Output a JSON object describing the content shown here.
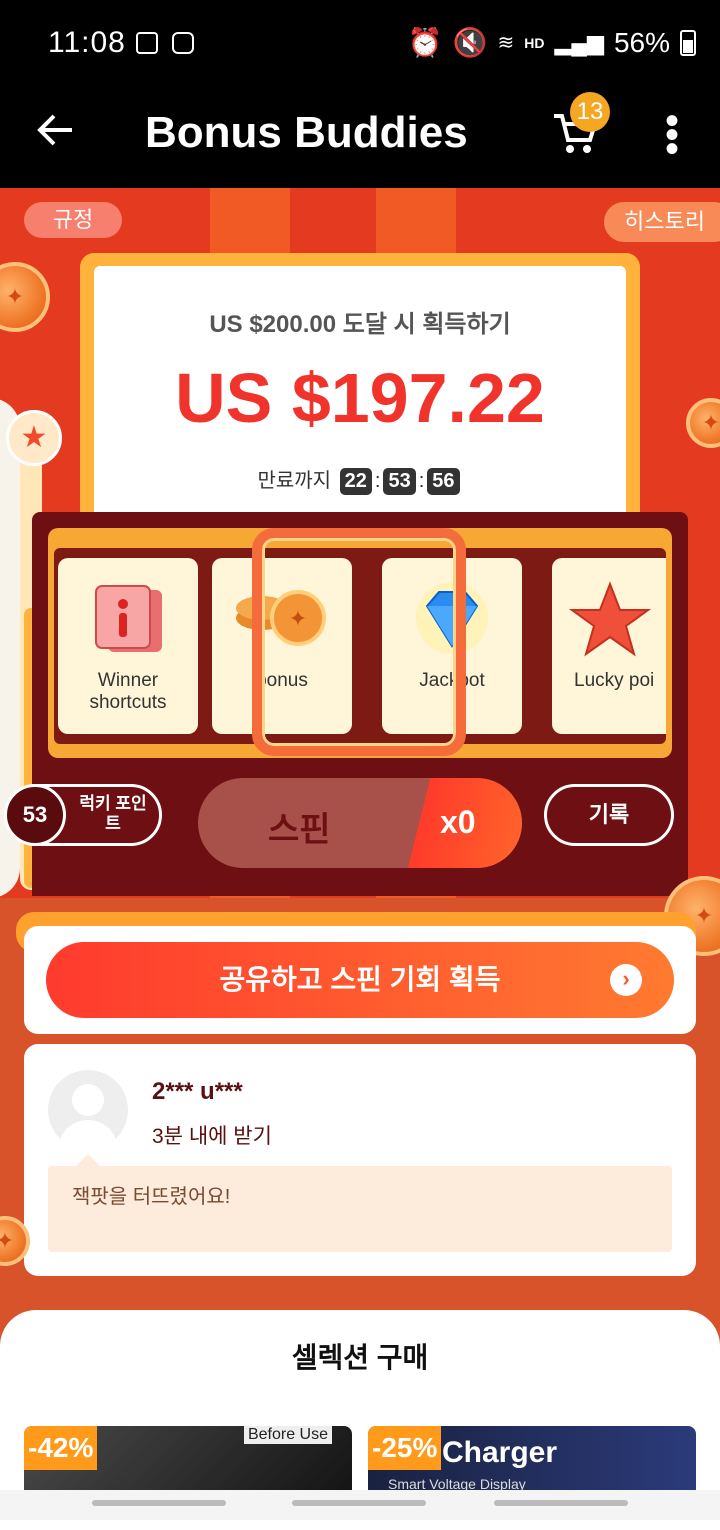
{
  "status": {
    "time": "11:08",
    "battery": "56%",
    "network": "HD"
  },
  "header": {
    "title": "Bonus Buddies",
    "back_icon": "arrow-left-icon",
    "cart_count": "13"
  },
  "hero": {
    "rules_label": "규정",
    "history_label": "히스토리",
    "target_text": "US $200.00 도달 시 획득하기",
    "amount": "US $197.22",
    "expiry_label": "만료까지",
    "timer": {
      "h": "22",
      "m": "53",
      "s": "56"
    }
  },
  "slots": [
    {
      "label": "Winner shortcuts",
      "icon": "info-ticket-icon"
    },
    {
      "label": "bonus",
      "icon": "coins-icon"
    },
    {
      "label": "Jackpot",
      "icon": "diamond-icon"
    },
    {
      "label": "Lucky poi",
      "icon": "star-icon"
    }
  ],
  "controls": {
    "lucky_points": "53",
    "lucky_label": "럭키 포인트",
    "spin_label": "스핀",
    "spin_multiplier": "x0",
    "record_label": "기록"
  },
  "share": {
    "label": "공유하고 스핀 기회 획득"
  },
  "winner": {
    "name": "2*** u***",
    "time": "3분 내에 받기",
    "message": "잭팟을 터뜨렸어요!"
  },
  "selection": {
    "title": "셀렉션 구매",
    "products": [
      {
        "discount": "-42%",
        "caption": "Before Use"
      },
      {
        "discount": "-25%",
        "caption": "Charger",
        "sub": "Smart Voltage Display"
      }
    ]
  }
}
